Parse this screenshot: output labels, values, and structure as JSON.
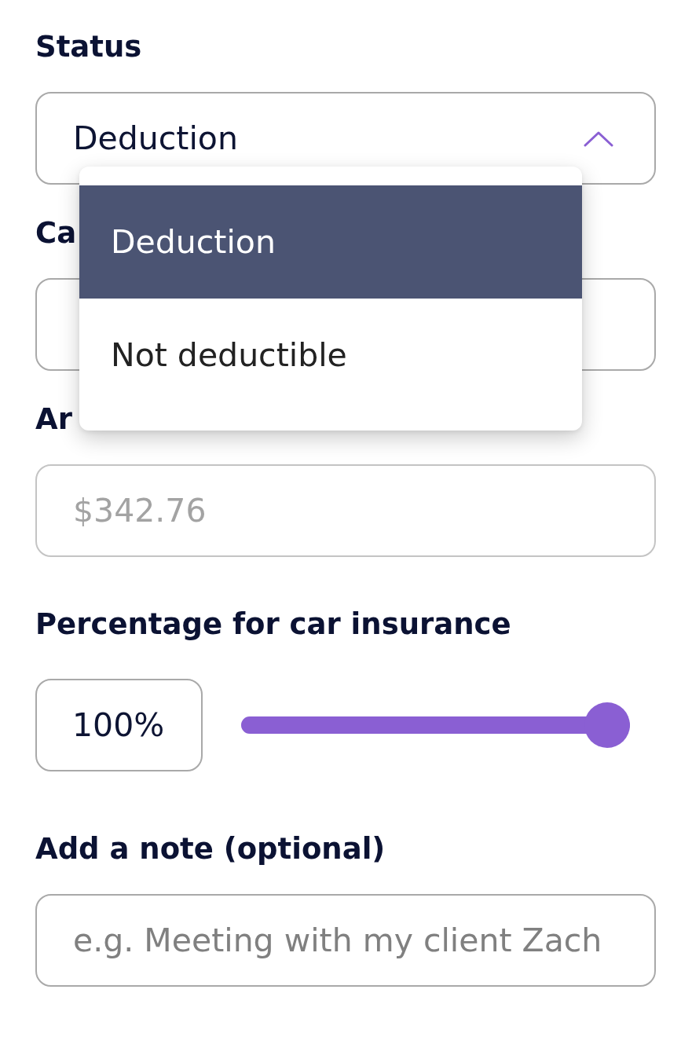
{
  "fields": [
    {
      "kind": "select",
      "label": "Status",
      "value": "Deduction",
      "expanded": true,
      "disabled": false,
      "options": [
        {
          "label": "Deduction",
          "selected": true
        },
        {
          "label": "Not deductible",
          "selected": false
        }
      ]
    },
    {
      "kind": "input",
      "label": "Ca",
      "disabled": false
    },
    {
      "kind": "input",
      "label": "Ar",
      "value": "$342.76",
      "disabled": true
    },
    {
      "kind": "slider",
      "label": "Percentage for car insurance",
      "reading": "100%",
      "level": 1,
      "disabled": false
    },
    {
      "kind": "input",
      "label": "Add a note (optional)",
      "placeholder": "e.g. Meeting with my client Zach",
      "disabled": false
    }
  ]
}
